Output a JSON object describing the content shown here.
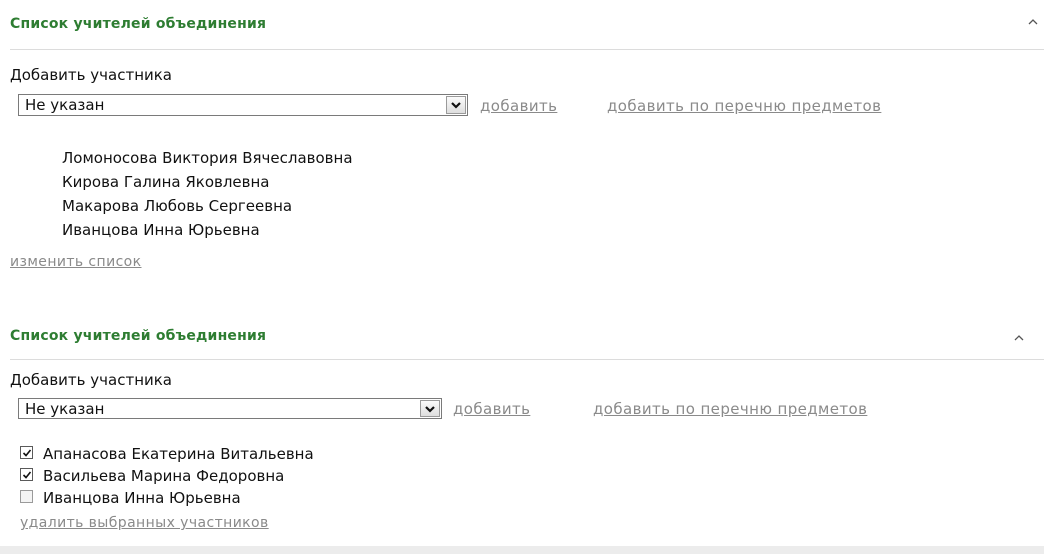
{
  "panels": [
    {
      "title": "Список учителей объединения",
      "add_member_label": "Добавить участника",
      "select_value": "Не указан",
      "add_link": "добавить",
      "add_by_subjects_link": "добавить по перечню предметов",
      "members": [
        "Ломоносова Виктория Вячеславовна",
        "Кирова Галина Яковлевна",
        "Макарова Любовь Сергеевна",
        "Иванцова Инна Юрьевна"
      ],
      "change_list_link": "изменить список"
    },
    {
      "title": "Список учителей объединения",
      "add_member_label": "Добавить участника",
      "select_value": "Не указан",
      "add_link": "добавить",
      "add_by_subjects_link": "добавить по перечню предметов",
      "members": [
        {
          "name": "Апанасова Екатерина Витальевна",
          "checked": true
        },
        {
          "name": "Васильева Марина Федоровна",
          "checked": true
        },
        {
          "name": "Иванцова Инна Юрьевна",
          "checked": false
        }
      ],
      "delete_selected_link": "удалить выбранных участников"
    }
  ],
  "icons": {
    "collapse": "chevron-up-icon",
    "dropdown": "chevron-down-icon",
    "check": "checkmark-icon"
  },
  "colors": {
    "title": "#2e7d32",
    "link": "#8a8a8a",
    "divider": "#dcdcdc"
  }
}
